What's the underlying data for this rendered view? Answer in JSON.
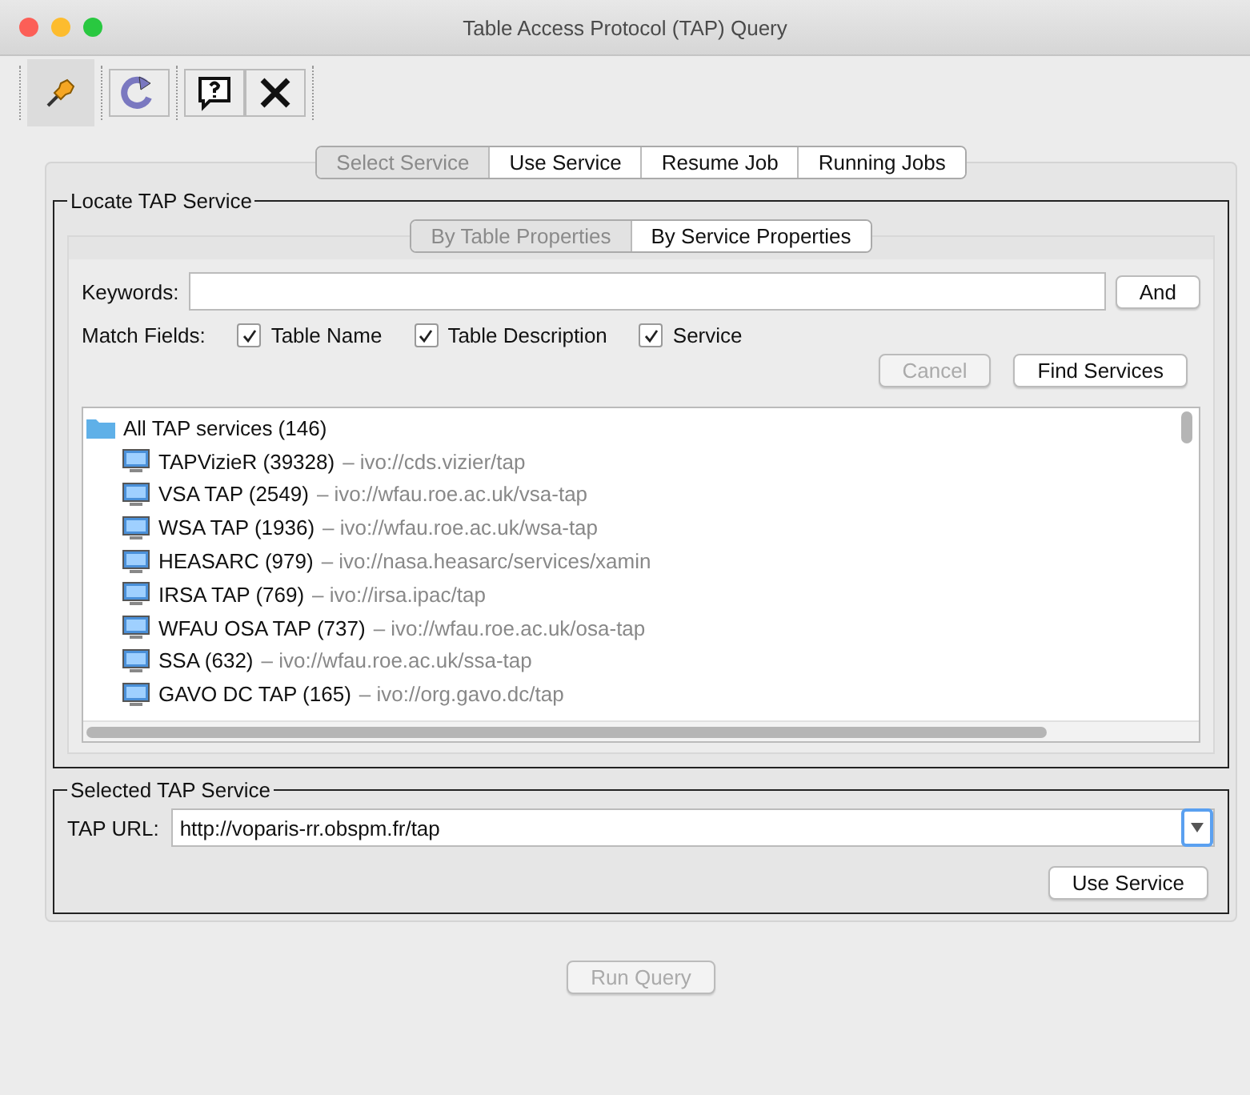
{
  "window": {
    "title": "Table Access Protocol (TAP) Query"
  },
  "toolbar": [
    {
      "kind": "pin",
      "selected": true
    },
    {
      "kind": "refresh",
      "selected": false
    },
    {
      "kind": "help",
      "selected": false
    },
    {
      "kind": "close",
      "selected": false
    }
  ],
  "tabs": [
    {
      "label": "Select Service",
      "selected": true
    },
    {
      "label": "Use Service",
      "selected": false
    },
    {
      "label": "Resume Job",
      "selected": false
    },
    {
      "label": "Running Jobs",
      "selected": false
    }
  ],
  "locate": {
    "title": "Locate TAP Service",
    "tabs": [
      {
        "label": "By Table Properties",
        "selected": true
      },
      {
        "label": "By Service Properties",
        "selected": false
      }
    ],
    "keywords_label": "Keywords:",
    "and_button": "And",
    "match_label": "Match Fields:",
    "match_fields": [
      {
        "label": "Table Name",
        "checked": true
      },
      {
        "label": "Table Description",
        "checked": true
      },
      {
        "label": "Service",
        "checked": true
      }
    ],
    "cancel_button": {
      "label": "Cancel",
      "disabled": true
    },
    "find_button": {
      "label": "Find Services",
      "disabled": false
    },
    "tree": {
      "label": "All TAP services (146)",
      "children": [
        {
          "label": "TAPVizieR (39328)",
          "detail": "– ivo://cds.vizier/tap"
        },
        {
          "label": "VSA TAP (2549)",
          "detail": "– ivo://wfau.roe.ac.uk/vsa-tap"
        },
        {
          "label": "WSA TAP (1936)",
          "detail": "– ivo://wfau.roe.ac.uk/wsa-tap"
        },
        {
          "label": "HEASARC (979)",
          "detail": "– ivo://nasa.heasarc/services/xamin"
        },
        {
          "label": "IRSA TAP (769)",
          "detail": "– ivo://irsa.ipac/tap"
        },
        {
          "label": "WFAU OSA TAP (737)",
          "detail": "– ivo://wfau.roe.ac.uk/osa-tap"
        },
        {
          "label": "SSA (632)",
          "detail": "– ivo://wfau.roe.ac.uk/ssa-tap"
        },
        {
          "label": "GAVO DC TAP (165)",
          "detail": "– ivo://org.gavo.dc/tap"
        }
      ]
    }
  },
  "selected": {
    "title": "Selected TAP Service",
    "url_label": "TAP URL:",
    "url": "http://voparis-rr.obspm.fr/tap",
    "use_button": {
      "label": "Use Service",
      "disabled": false
    }
  },
  "run_button": {
    "label": "Run Query",
    "disabled": true
  }
}
